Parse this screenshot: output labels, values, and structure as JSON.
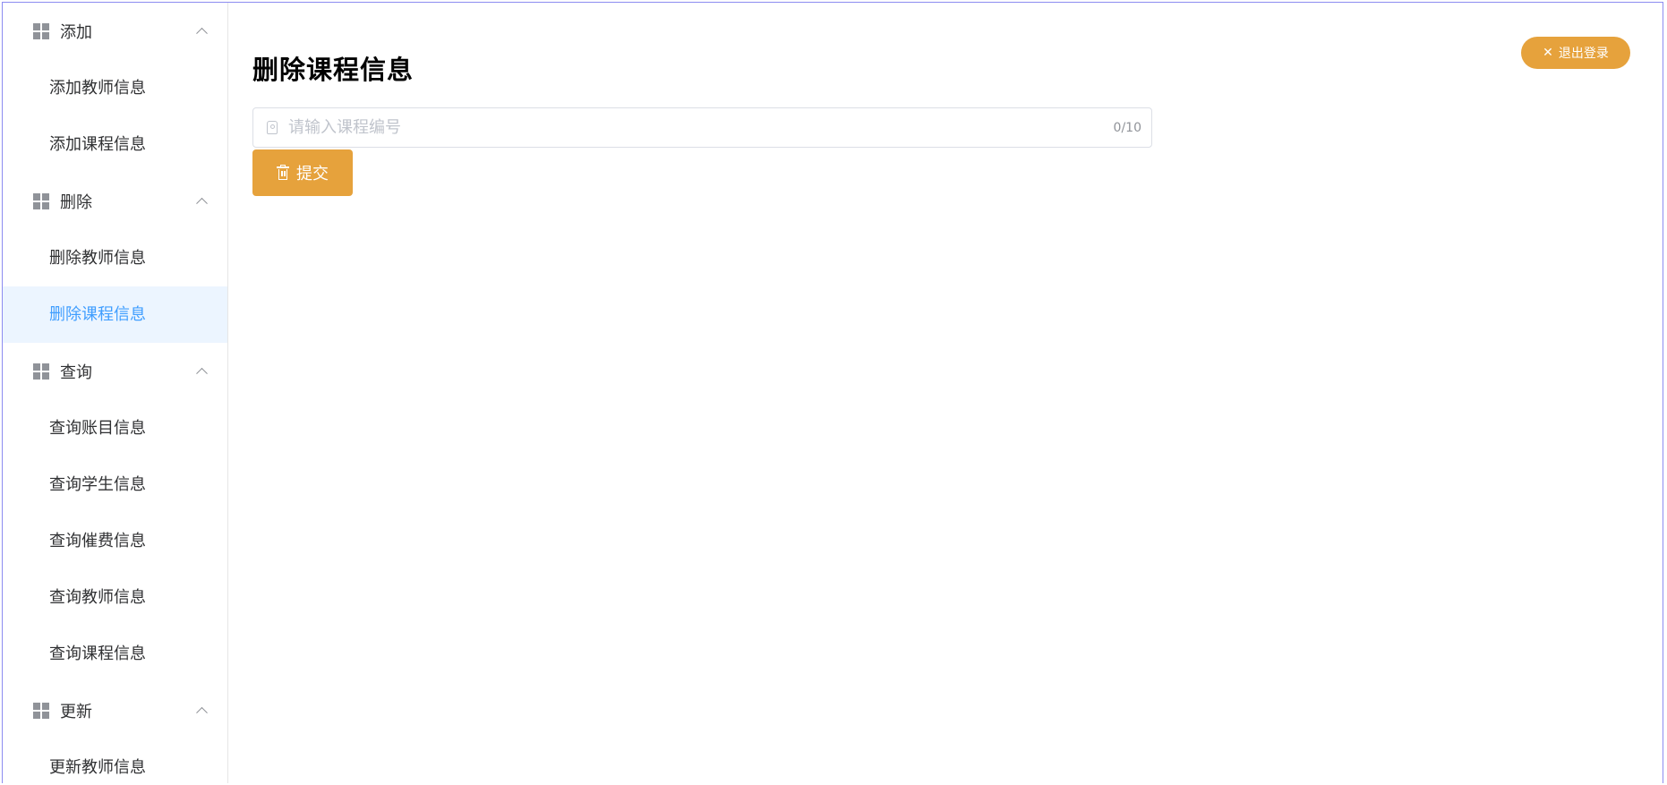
{
  "sidebar": {
    "groups": [
      {
        "title": "添加",
        "icon": "grid-icon",
        "items": [
          "添加教师信息",
          "添加课程信息"
        ]
      },
      {
        "title": "删除",
        "icon": "grid-icon",
        "items": [
          "删除教师信息",
          "删除课程信息"
        ]
      },
      {
        "title": "查询",
        "icon": "grid-icon",
        "items": [
          "查询账目信息",
          "查询学生信息",
          "查询催费信息",
          "查询教师信息",
          "查询课程信息"
        ]
      },
      {
        "title": "更新",
        "icon": "grid-icon",
        "items": [
          "更新教师信息"
        ]
      }
    ],
    "active_item": "删除课程信息"
  },
  "header": {
    "logout_label": "退出登录",
    "logout_icon": "close-icon"
  },
  "main": {
    "title": "删除课程信息",
    "input": {
      "placeholder": "请输入课程编号",
      "value": "",
      "counter": "0/10",
      "prefix_icon": "tag-icon"
    },
    "submit_label": "提交",
    "submit_icon": "trash-icon"
  },
  "colors": {
    "accent_warning": "#e6a23c",
    "active_text": "#409eff",
    "active_bg": "#ecf5ff",
    "frame_border": "#8c8cf0"
  }
}
